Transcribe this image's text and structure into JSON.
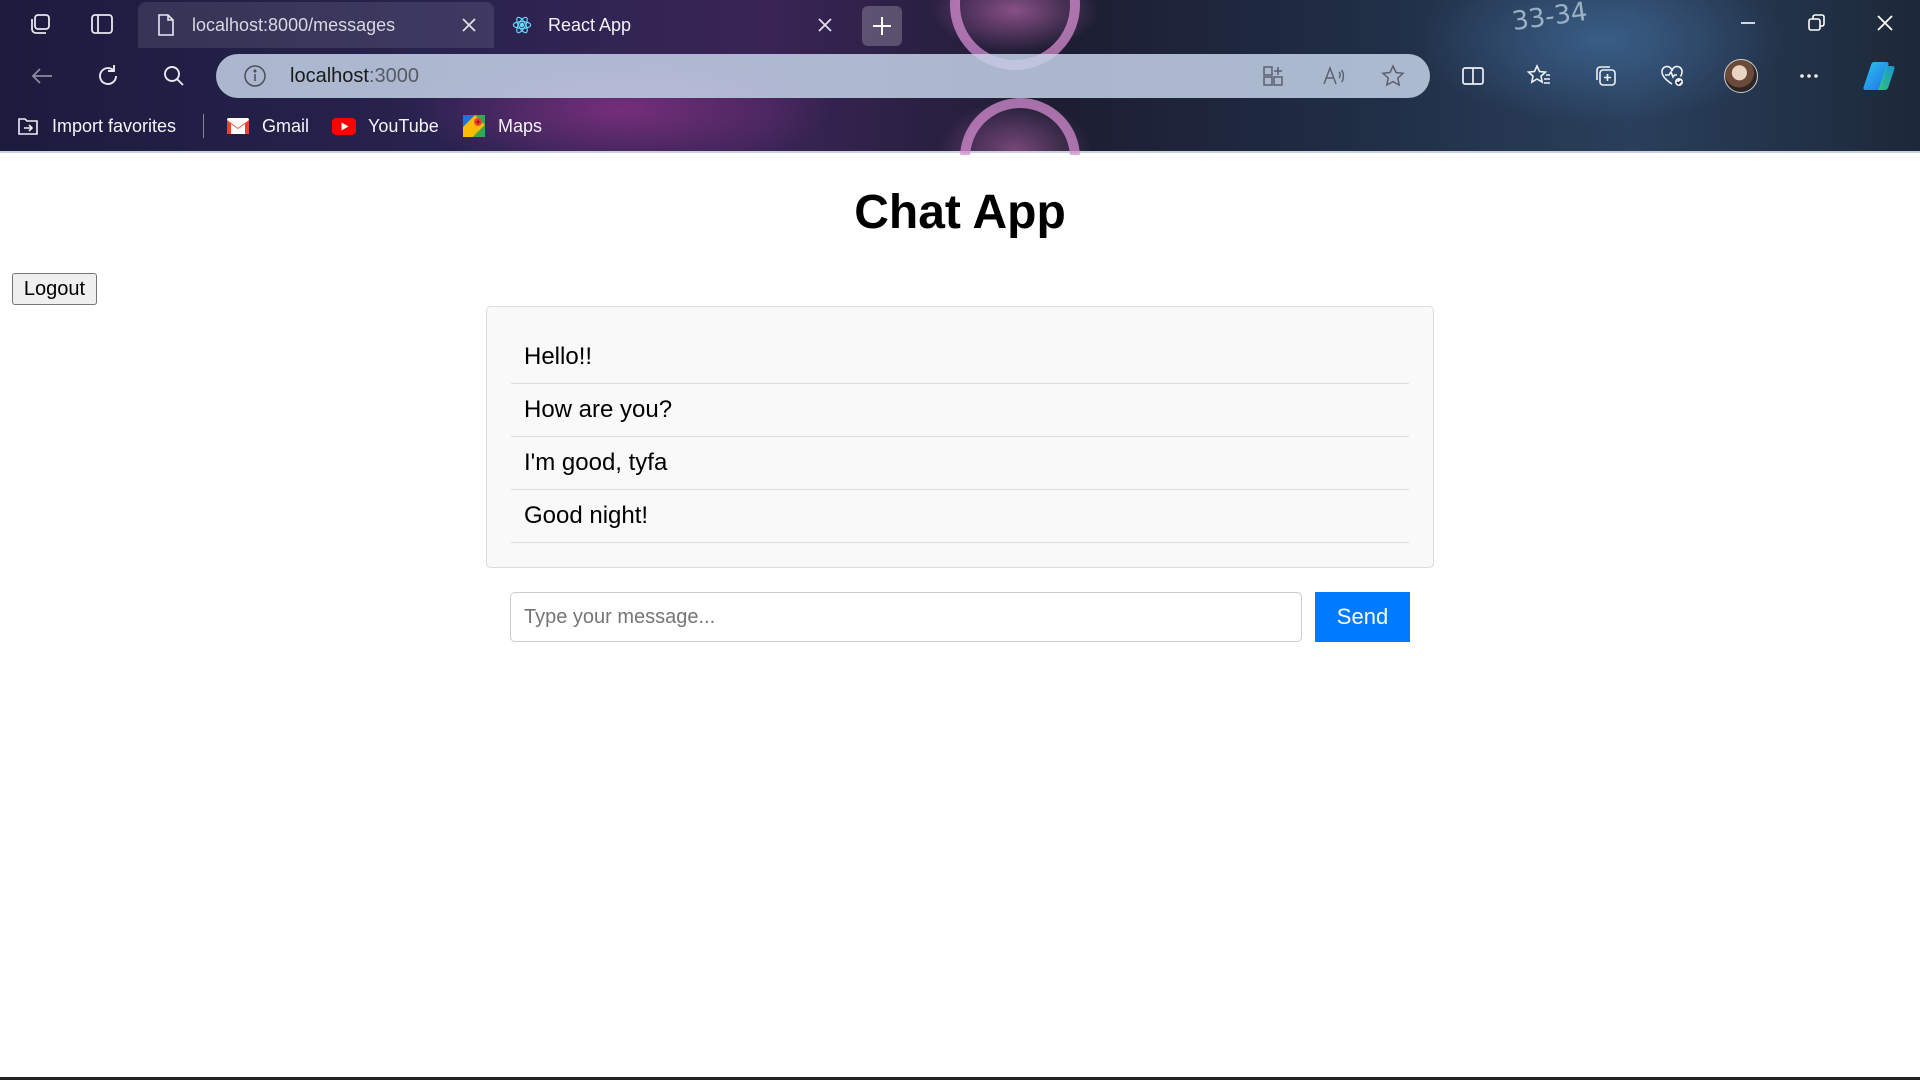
{
  "browser": {
    "tabs": [
      {
        "title": "localhost:8000/messages",
        "icon": "page-icon",
        "active": false
      },
      {
        "title": "React App",
        "icon": "react-icon",
        "active": true
      }
    ],
    "deco_text": "33-34",
    "address": {
      "host": "localhost",
      "port": ":3000"
    },
    "favorites": [
      {
        "label": "Import favorites",
        "icon": "import-favorites-icon"
      },
      {
        "label": "Gmail",
        "icon": "gmail-icon"
      },
      {
        "label": "YouTube",
        "icon": "youtube-icon"
      },
      {
        "label": "Maps",
        "icon": "maps-icon"
      }
    ]
  },
  "app": {
    "title": "Chat App",
    "logout_label": "Logout",
    "messages": [
      "Hello!!",
      "How are you?",
      "I'm good, tyfa",
      "Good night!"
    ],
    "input": {
      "placeholder": "Type your message...",
      "value": ""
    },
    "send_label": "Send",
    "colors": {
      "send_button": "#007bff",
      "message_box_bg": "#f9f9f9"
    }
  }
}
